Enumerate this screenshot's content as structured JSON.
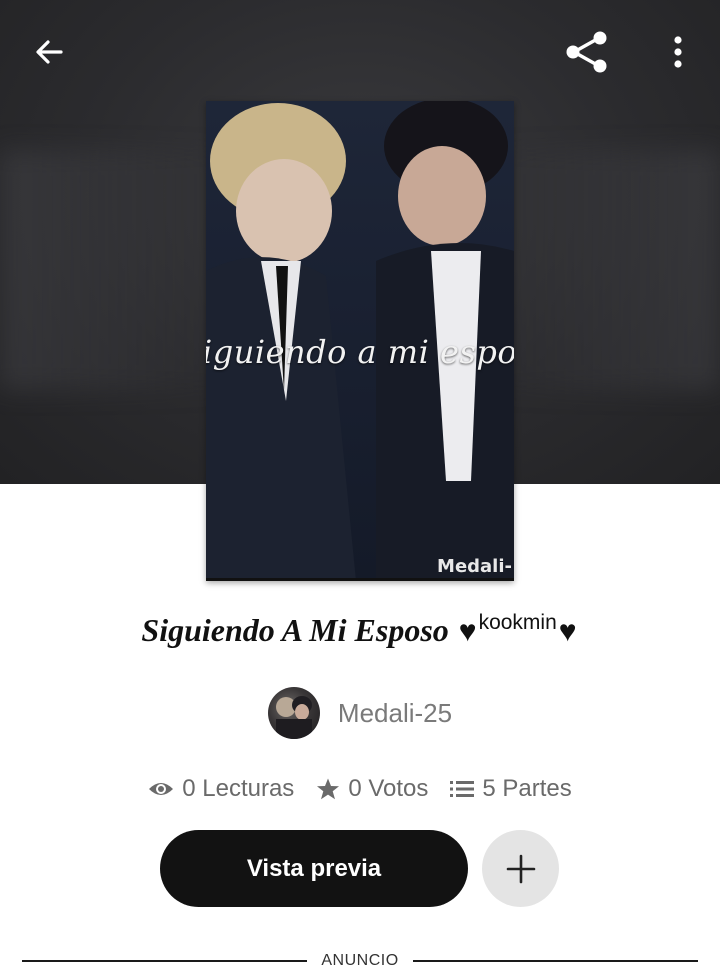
{
  "header": {
    "back_icon": "arrow-left-icon",
    "share_icon": "share-icon",
    "more_icon": "more-vertical-icon"
  },
  "cover": {
    "overlay_text": "iguiendo a mi esposo",
    "credit": "Medali-"
  },
  "story": {
    "title": "Siguiendo A Mi Esposo",
    "title_heart": "♥",
    "title_tag": "kookmin"
  },
  "author": {
    "name": "Medali-25"
  },
  "stats": {
    "reads": "0 Lecturas",
    "votes": "0 Votos",
    "parts": "5 Partes"
  },
  "actions": {
    "preview_label": "Vista previa",
    "add_icon": "plus-icon"
  },
  "ad": {
    "label": "ANUNCIO"
  },
  "colors": {
    "primary_button": "#121212",
    "secondary_button": "#e4e4e4",
    "muted_text": "#6a6a6a"
  }
}
